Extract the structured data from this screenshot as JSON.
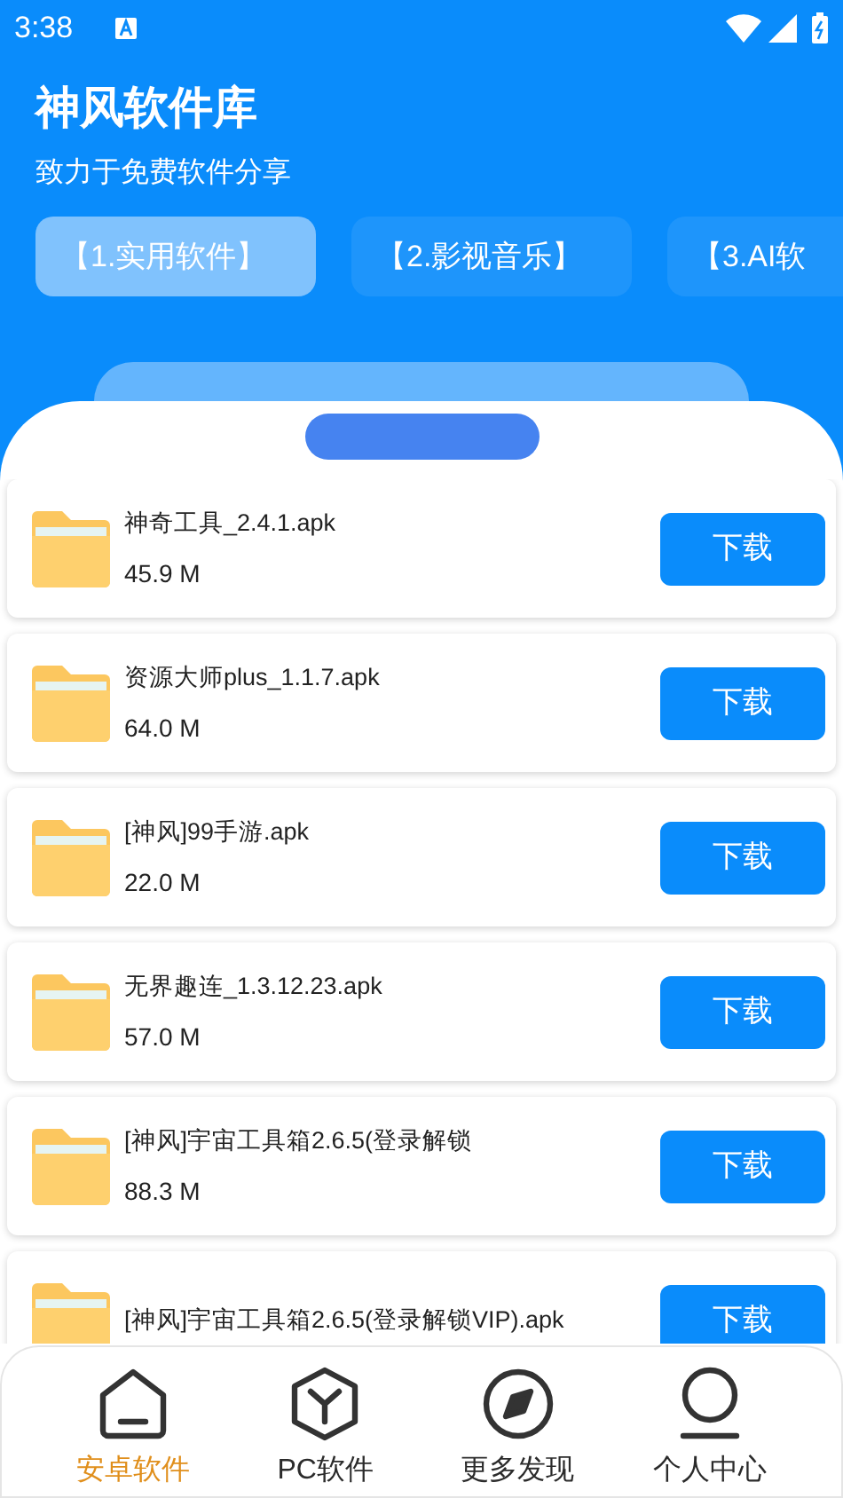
{
  "status_bar": {
    "time": "3:38"
  },
  "header": {
    "title": "神风软件库",
    "subtitle": "致力于免费软件分享"
  },
  "tabs": [
    {
      "label": "【1.实用软件】",
      "selected": true
    },
    {
      "label": "【2.影视音乐】",
      "selected": false
    },
    {
      "label": "【3.AI软",
      "selected": false
    }
  ],
  "files": [
    {
      "name": "神奇工具_2.4.1.apk",
      "size": "45.9 M",
      "button": "下载"
    },
    {
      "name": "资源大师plus_1.1.7.apk",
      "size": "64.0 M",
      "button": "下载"
    },
    {
      "name": "[神风]99手游.apk",
      "size": "22.0 M",
      "button": "下载"
    },
    {
      "name": "无界趣连_1.3.12.23.apk",
      "size": "57.0 M",
      "button": "下载"
    },
    {
      "name": "[神风]宇宙工具箱2.6.5(登录解锁",
      "size": "88.3 M",
      "button": "下载"
    },
    {
      "name": "[神风]宇宙工具箱2.6.5(登录解锁VIP).apk",
      "button": "下载"
    }
  ],
  "nav": [
    {
      "label": "安卓软件",
      "kind": "home",
      "selected": true
    },
    {
      "label": "PC软件",
      "kind": "cube",
      "selected": false
    },
    {
      "label": "更多发现",
      "kind": "compass",
      "selected": false
    },
    {
      "label": "个人中心",
      "kind": "person",
      "selected": false
    }
  ]
}
